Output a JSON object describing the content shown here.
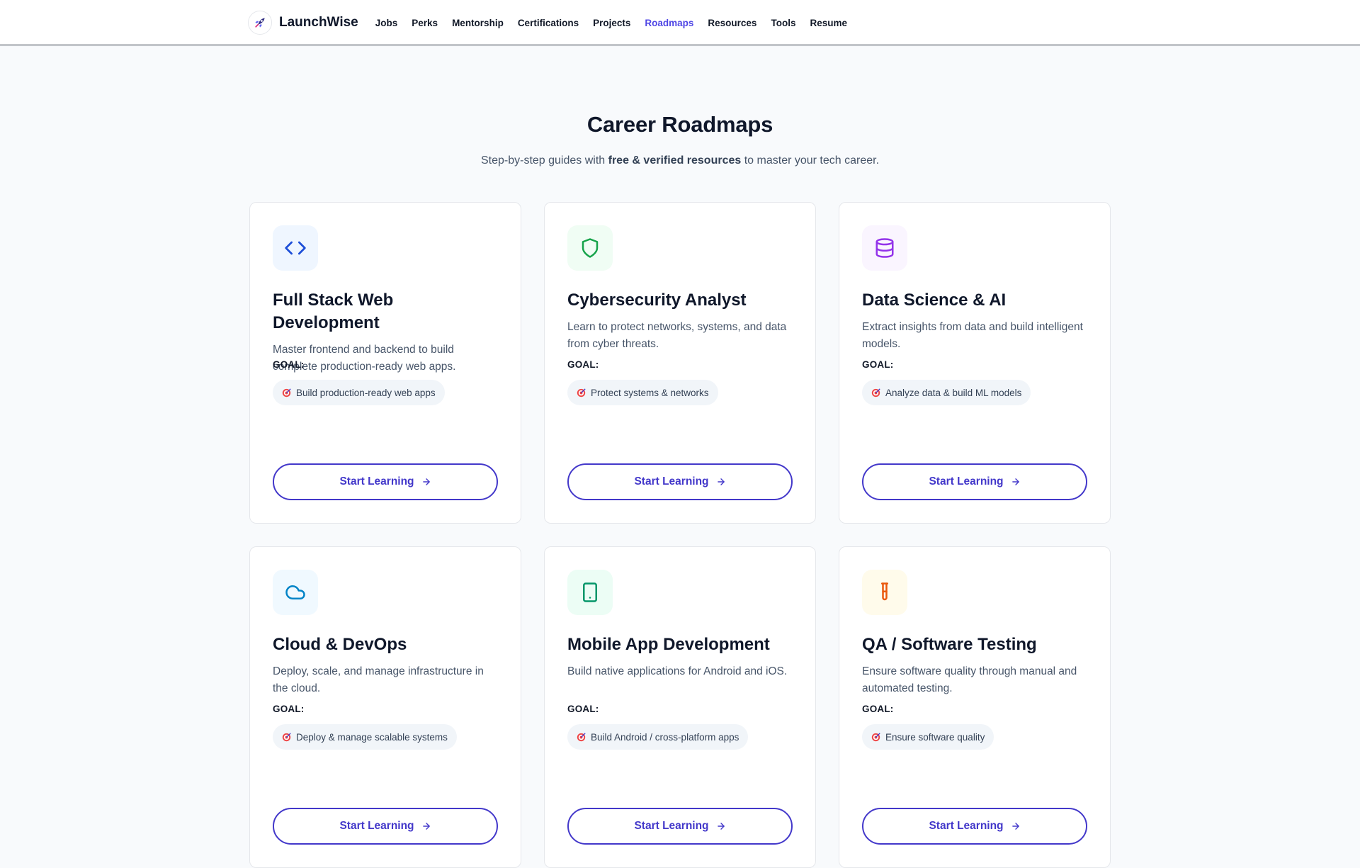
{
  "nav": {
    "brand": "LaunchWise",
    "links": [
      "Jobs",
      "Perks",
      "Mentorship",
      "Certifications",
      "Projects",
      "Roadmaps",
      "Resources",
      "Tools",
      "Resume"
    ],
    "active": "Roadmaps"
  },
  "hero": {
    "title": "Career Roadmaps",
    "subtitle_pre": "Step-by-step guides with ",
    "subtitle_bold": "free & verified resources",
    "subtitle_post": " to master your tech career."
  },
  "goal_label": "GOAL:",
  "button_label": "Start Learning",
  "cards": [
    {
      "title": "Full Stack Web Development",
      "desc": "Master frontend and backend to build complete production-ready web apps.",
      "goal": "Build production-ready web apps",
      "icon": "code-icon",
      "icon_color": "#1d4ed8",
      "icon_bg": "#eff6ff"
    },
    {
      "title": "Cybersecurity Analyst",
      "desc": "Learn to protect networks, systems, and data from cyber threats.",
      "goal": "Protect systems & networks",
      "icon": "shield-icon",
      "icon_color": "#16a34a",
      "icon_bg": "#f0fdf4"
    },
    {
      "title": "Data Science & AI",
      "desc": "Extract insights from data and build intelligent models.",
      "goal": "Analyze data & build ML models",
      "icon": "database-icon",
      "icon_color": "#9333ea",
      "icon_bg": "#faf5ff"
    },
    {
      "title": "Cloud & DevOps",
      "desc": "Deploy, scale, and manage infrastructure in the cloud.",
      "goal": "Deploy & manage scalable systems",
      "icon": "cloud-icon",
      "icon_color": "#0284c7",
      "icon_bg": "#f0f9ff"
    },
    {
      "title": "Mobile App Development",
      "desc": "Build native applications for Android and iOS.",
      "goal": "Build Android / cross-platform apps",
      "icon": "tablet-icon",
      "icon_color": "#059669",
      "icon_bg": "#ecfdf5"
    },
    {
      "title": "QA / Software Testing",
      "desc": "Ensure software quality through manual and automated testing.",
      "goal": "Ensure software quality",
      "icon": "test-tube-icon",
      "icon_color": "#ea580c",
      "icon_bg": "#fffbeb"
    }
  ]
}
